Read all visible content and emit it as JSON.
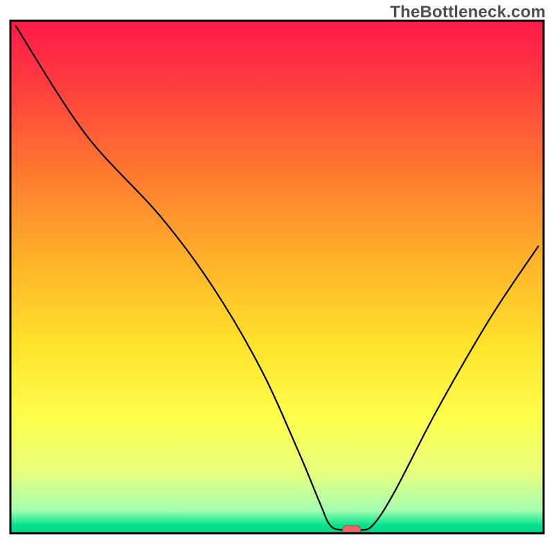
{
  "watermark": "TheBottleneck.com",
  "chart_data": {
    "type": "line",
    "title": "",
    "xlabel": "",
    "ylabel": "",
    "xlim": [
      0,
      100
    ],
    "ylim": [
      0,
      100
    ],
    "grid": false,
    "legend": false,
    "note": "A black V-shaped curve over a vertical heat gradient. X is a normalized component/performance axis; Y is a normalized bottleneck magnitude (0 at bottom = no bottleneck, 100 at top = maximal). Values are read off approximate pixel positions; no axes/ticks are rendered.",
    "background_gradient": {
      "direction": "vertical",
      "stops": [
        {
          "pos": 0.0,
          "color": "#ff1a4a"
        },
        {
          "pos": 0.12,
          "color": "#ff3b3f"
        },
        {
          "pos": 0.3,
          "color": "#ff7a2f"
        },
        {
          "pos": 0.48,
          "color": "#ffb62a"
        },
        {
          "pos": 0.63,
          "color": "#ffe22a"
        },
        {
          "pos": 0.78,
          "color": "#fdff4d"
        },
        {
          "pos": 0.88,
          "color": "#e8ff7c"
        },
        {
          "pos": 0.955,
          "color": "#a6ffb0"
        },
        {
          "pos": 0.985,
          "color": "#00e38b"
        },
        {
          "pos": 1.0,
          "color": "#00d488"
        }
      ]
    },
    "series": [
      {
        "name": "bottleneck-curve",
        "points": [
          {
            "x": 1.0,
            "y": 99.0
          },
          {
            "x": 14.0,
            "y": 78.0
          },
          {
            "x": 28.0,
            "y": 62.0
          },
          {
            "x": 38.0,
            "y": 48.0
          },
          {
            "x": 47.0,
            "y": 32.0
          },
          {
            "x": 54.0,
            "y": 16.0
          },
          {
            "x": 58.0,
            "y": 6.0
          },
          {
            "x": 60.0,
            "y": 1.5
          },
          {
            "x": 62.5,
            "y": 0.6
          },
          {
            "x": 65.5,
            "y": 0.6
          },
          {
            "x": 68.0,
            "y": 1.6
          },
          {
            "x": 72.0,
            "y": 8.0
          },
          {
            "x": 80.0,
            "y": 24.0
          },
          {
            "x": 90.0,
            "y": 42.0
          },
          {
            "x": 99.0,
            "y": 56.0
          }
        ]
      }
    ],
    "marker": {
      "name": "optimal-point",
      "x": 64.0,
      "y": 0.6,
      "shape": "capsule",
      "fill": "#e46a6a",
      "stroke": "#b54040"
    },
    "axes_box": {
      "stroke": "#000000",
      "stroke_width": 3
    }
  }
}
